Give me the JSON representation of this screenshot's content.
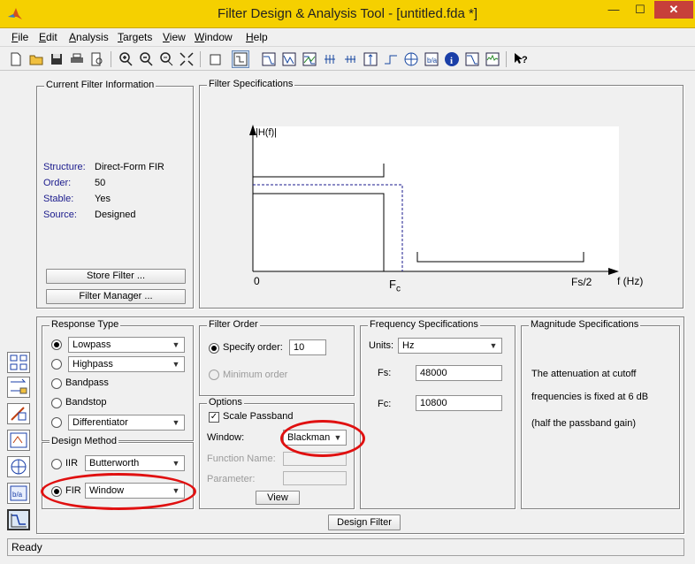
{
  "window": {
    "title": "Filter Design & Analysis Tool -  [untitled.fda *]",
    "minimize": "—",
    "maximize": "☐",
    "close": "✕"
  },
  "menu": [
    {
      "label": "File",
      "mnemonic": "F",
      "rest": "ile"
    },
    {
      "label": "Edit",
      "mnemonic": "E",
      "rest": "dit"
    },
    {
      "label": "Analysis",
      "mnemonic": "A",
      "rest": "nalysis"
    },
    {
      "label": "Targets",
      "mnemonic": "T",
      "rest": "argets"
    },
    {
      "label": "View",
      "mnemonic": "V",
      "rest": "iew"
    },
    {
      "label": "Window",
      "mnemonic": "W",
      "rest": "indow"
    },
    {
      "label": "Help",
      "mnemonic": "H",
      "rest": "elp"
    }
  ],
  "current_filter": {
    "title": "Current Filter Information",
    "structure_label": "Structure:",
    "structure_value": "Direct-Form FIR",
    "order_label": "Order:",
    "order_value": "50",
    "stable_label": "Stable:",
    "stable_value": "Yes",
    "source_label": "Source:",
    "source_value": "Designed",
    "store_button": "Store Filter ...",
    "manager_button": "Filter Manager ..."
  },
  "filter_specs": {
    "title": "Filter Specifications",
    "y_label": "|H(f)|",
    "origin": "0",
    "fc_main": "F",
    "fc_sub": "c",
    "fs2": "Fs/2",
    "f_label": "f (Hz)"
  },
  "response_type": {
    "title": "Response Type",
    "lowpass": "Lowpass",
    "highpass": "Highpass",
    "bandpass": "Bandpass",
    "bandstop": "Bandstop",
    "differentiator": "Differentiator"
  },
  "design_method": {
    "title": "Design Method",
    "iir_label": "IIR",
    "iir_value": "Butterworth",
    "fir_label": "FIR",
    "fir_value": "Window"
  },
  "filter_order": {
    "title": "Filter Order",
    "specify_label": "Specify order:",
    "order_value": "10",
    "minimum_label": "Minimum order"
  },
  "options": {
    "title": "Options",
    "scale_passband": "Scale Passband",
    "window_label": "Window:",
    "window_value": "Blackman",
    "function_name_label": "Function Name:",
    "parameter_label": "Parameter:",
    "view_button": "View"
  },
  "frequency_specs": {
    "title": "Frequency Specifications",
    "units_label": "Units:",
    "units_value": "Hz",
    "fs_label": "Fs:",
    "fs_value": "48000",
    "fc_label": "Fc:",
    "fc_value": "10800"
  },
  "magnitude_specs": {
    "title": "Magnitude Specifications",
    "line1": "The attenuation at cutoff",
    "line2": "frequencies is fixed at 6 dB",
    "line3": "(half the passband gain)"
  },
  "design_button": "Design Filter",
  "status": "Ready",
  "colors": {
    "titlebar": "#f5d000",
    "close": "#c7403a",
    "highlight": "#e01010",
    "label_blue": "#1a1a8c"
  }
}
